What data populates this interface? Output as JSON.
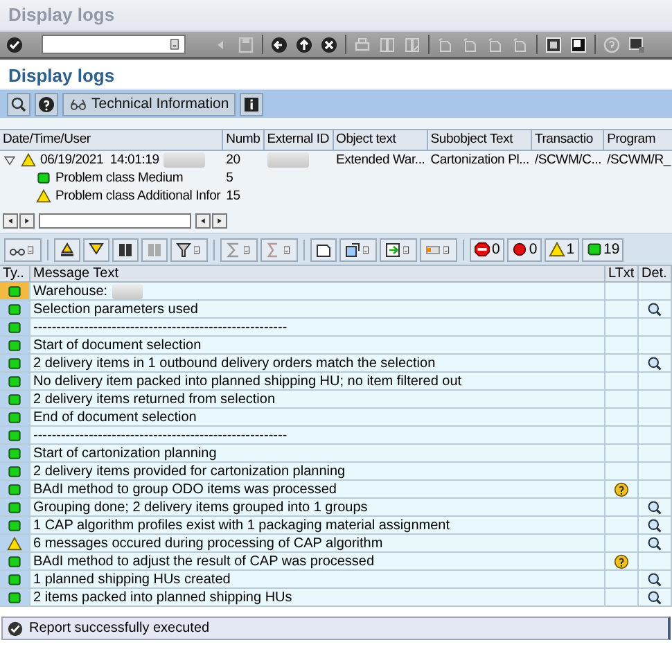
{
  "window": {
    "title": "Display logs"
  },
  "page_title": "Display logs",
  "app_toolbar": {
    "technical_info_button": "Technical Information"
  },
  "log_tree": {
    "columns": [
      "Date/Time/User",
      "Numb",
      "External ID",
      "Object text",
      "Subobject Text",
      "Transactio",
      "Program"
    ],
    "rows": [
      {
        "kind": "warning",
        "expanded": true,
        "redacted": true,
        "date_time": "06/19/2021  14:01:19",
        "number": "20",
        "object_text": "Extended War...",
        "subobject_text": "Cartonization Pl...",
        "transaction": "/SCWM/C...",
        "program": "/SCWM/R_",
        "children": [
          {
            "kind": "success",
            "text": "Problem class Medium",
            "number": "5"
          },
          {
            "kind": "warning",
            "text": "Problem class Additional Infor",
            "number": "15"
          }
        ]
      }
    ]
  },
  "message_toolbar": {
    "counters": [
      {
        "kind": "stop",
        "count": "0"
      },
      {
        "kind": "error",
        "count": "0"
      },
      {
        "kind": "warning",
        "count": "1"
      },
      {
        "kind": "success",
        "count": "19"
      }
    ]
  },
  "messages": {
    "columns": [
      "Ty..",
      "Message Text",
      "LTxt",
      "Det."
    ],
    "rows": [
      {
        "kind": "success",
        "text": "Warehouse:",
        "redacted": true,
        "long_text": false,
        "detail": false,
        "selected": true
      },
      {
        "kind": "success",
        "text": "Selection parameters used",
        "long_text": false,
        "detail": true,
        "selected": false
      },
      {
        "kind": "success",
        "text": "-------------------------------------------------------",
        "long_text": false,
        "detail": false,
        "selected": false
      },
      {
        "kind": "success",
        "text": "Start of document selection",
        "long_text": false,
        "detail": false,
        "selected": false
      },
      {
        "kind": "success",
        "text": "2 delivery items in 1 outbound delivery orders match the selection",
        "long_text": false,
        "detail": true,
        "selected": false
      },
      {
        "kind": "success",
        "text": "No delivery item packed into planned shipping HU; no item filtered out",
        "long_text": false,
        "detail": false,
        "selected": false
      },
      {
        "kind": "success",
        "text": "2 delivery items returned from selection",
        "long_text": false,
        "detail": false,
        "selected": false
      },
      {
        "kind": "success",
        "text": "End of document selection",
        "long_text": false,
        "detail": false,
        "selected": false
      },
      {
        "kind": "success",
        "text": "-------------------------------------------------------",
        "long_text": false,
        "detail": false,
        "selected": false
      },
      {
        "kind": "success",
        "text": "Start of cartonization planning",
        "long_text": false,
        "detail": false,
        "selected": false
      },
      {
        "kind": "success",
        "text": "2 delivery items provided for cartonization planning",
        "long_text": false,
        "detail": false,
        "selected": false
      },
      {
        "kind": "success",
        "text": "BAdI method to group ODO items was processed",
        "long_text": true,
        "detail": false,
        "selected": false
      },
      {
        "kind": "success",
        "text": "Grouping done; 2 delivery items grouped into 1 groups",
        "long_text": false,
        "detail": true,
        "selected": false
      },
      {
        "kind": "success",
        "text": "1 CAP algorithm profiles exist with 1 packaging material assignment",
        "long_text": false,
        "detail": true,
        "selected": false
      },
      {
        "kind": "warning",
        "text": "6 messages occured during processing of CAP algorithm",
        "long_text": false,
        "detail": true,
        "selected": false
      },
      {
        "kind": "success",
        "text": "BAdI method to adjust the result of CAP was processed",
        "long_text": true,
        "detail": false,
        "selected": false
      },
      {
        "kind": "success",
        "text": "1 planned shipping HUs created",
        "long_text": false,
        "detail": true,
        "selected": false
      },
      {
        "kind": "success",
        "text": "2 items packed into planned shipping HUs",
        "long_text": false,
        "detail": true,
        "selected": false
      }
    ]
  },
  "status_bar": {
    "kind": "success",
    "text": "Report successfully executed"
  }
}
